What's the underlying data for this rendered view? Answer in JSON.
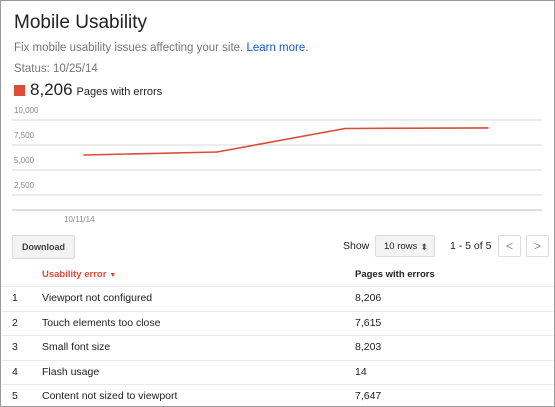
{
  "page": {
    "title": "Mobile Usability",
    "subtitle": "Fix mobile usability issues affecting your site.",
    "learn_more": "Learn more.",
    "status": "Status: 10/25/14",
    "summary_value": "8,206",
    "summary_label": "Pages with errors",
    "accent_color": "#dd4b39"
  },
  "chart_data": {
    "type": "line",
    "x": [
      "10/11/14",
      "",
      "",
      ""
    ],
    "series": [
      {
        "values": [
          5500,
          5800,
          8150,
          8206
        ],
        "color": "#dd4b39"
      }
    ],
    "yticks": [
      "10,000",
      "7,500",
      "5,000",
      "2,500"
    ],
    "ytick_values": [
      10000,
      7500,
      5000,
      2500
    ],
    "xtick_label": "10/11/14",
    "ylim": [
      0,
      10000
    ],
    "grid": true
  },
  "toolbar": {
    "download": "Download",
    "show": "Show",
    "rows": "10 rows",
    "pager": "1 - 5 of 5",
    "prev": "<",
    "next": ">"
  },
  "table": {
    "headers": {
      "error": "Usability error",
      "sort_icon": "▼",
      "pages": "Pages with errors"
    },
    "rows": [
      {
        "num": "1",
        "error": "Viewport not configured",
        "pages": "8,206"
      },
      {
        "num": "2",
        "error": "Touch elements too close",
        "pages": "7,615"
      },
      {
        "num": "3",
        "error": "Small font size",
        "pages": "8,203"
      },
      {
        "num": "4",
        "error": "Flash usage",
        "pages": "14"
      },
      {
        "num": "5",
        "error": "Content not sized to viewport",
        "pages": "7,647"
      }
    ]
  }
}
